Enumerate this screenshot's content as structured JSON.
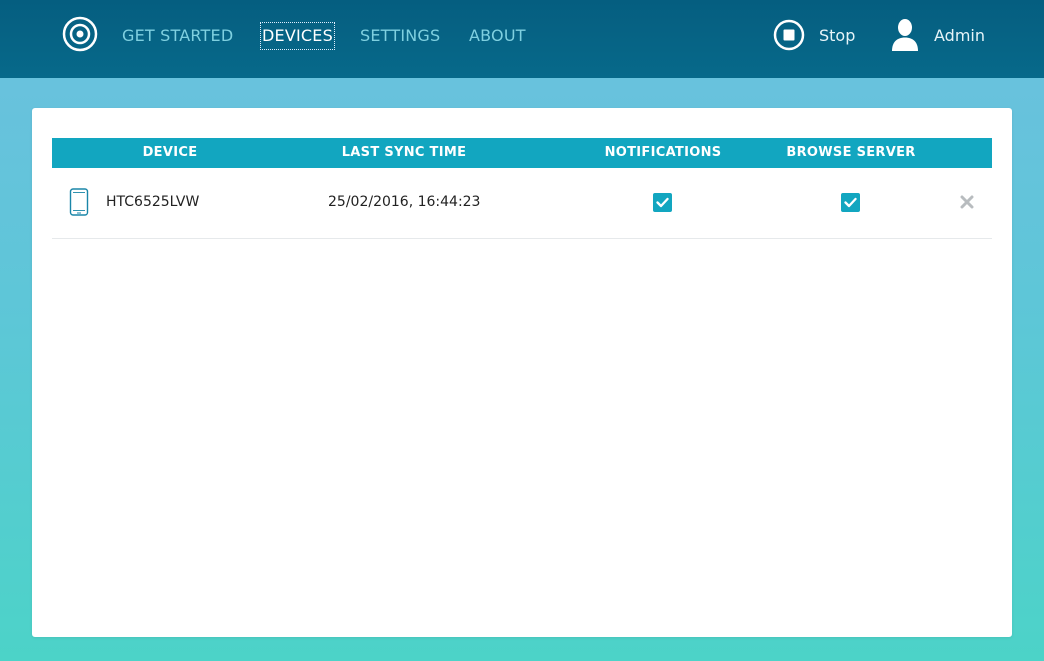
{
  "nav": {
    "items": [
      {
        "label": "GET STARTED"
      },
      {
        "label": "DEVICES"
      },
      {
        "label": "SETTINGS"
      },
      {
        "label": "ABOUT"
      }
    ],
    "active": "DEVICES",
    "stop_label": "Stop",
    "admin_label": "Admin"
  },
  "table": {
    "columns": [
      "DEVICE",
      "LAST SYNC TIME",
      "NOTIFICATIONS",
      "BROWSE SERVER"
    ],
    "rows": [
      {
        "device": "HTC6525LVW",
        "last_sync": "25/02/2016, 16:44:23",
        "notifications": true,
        "browse_server": true,
        "icon": "phone-icon"
      }
    ]
  },
  "colors": {
    "topbar": "#055e80",
    "accent": "#12a6c0",
    "nav_text": "#7fd0e0"
  }
}
